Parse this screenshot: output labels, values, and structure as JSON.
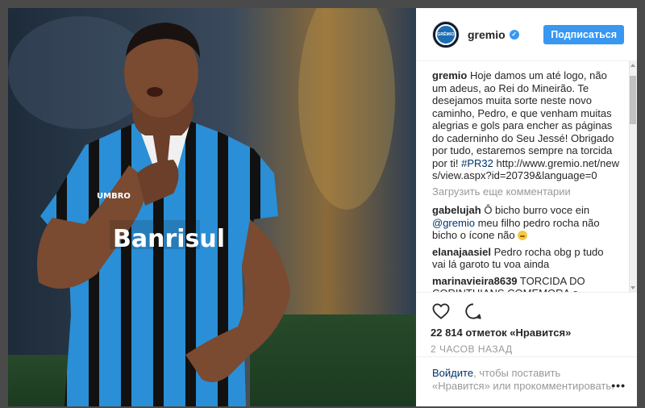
{
  "post": {
    "username": "gremio",
    "avatar_text": "GRÊMIO",
    "follow_label": "Подписаться",
    "caption_user": "gremio",
    "caption_text": "Hoje damos um até logo, não um adeus, ao Rei do Mineirão. Te desejamos muita sorte neste novo caminho, Pedro, e que venham muitas alegrias e gols para encher as páginas do caderninho do Seu Jessé! Obrigado por tudo, estaremos sempre na torcida por ti!",
    "caption_hashtag": "#PR32",
    "caption_url": "http://www.gremio.net/news/view.aspx?id=20739&language=0",
    "load_more": "Загрузить еще комментарии",
    "comments": [
      {
        "user": "gabelujah",
        "text_a": "Ô bicho burro voce ein",
        "mention": "@gremio",
        "text_b": "meu filho pedro rocha não bicho o ícone não"
      },
      {
        "user": "elanajaasiel",
        "text": "Pedro rocha obg p tudo vai lá garoto tu voa ainda"
      },
      {
        "user": "marinavieira8639",
        "text": "TORCIDA DO CORINTHIANS COMEMORA e ..."
      }
    ],
    "likes": "22 814 отметок «Нравится»",
    "time": "2 ЧАСОВ НАЗАД",
    "login_link": "Войдите",
    "login_text": ", чтобы поставить «Нравится» или прокомментировать.",
    "more_label": "•••",
    "icons": {
      "verified": "verified-check-icon",
      "like": "heart-outline-icon",
      "comment": "speech-bubble-icon",
      "more": "ellipsis-icon"
    },
    "photo_text": "Banrisul",
    "shirt_brand": "UMBRO"
  },
  "colors": {
    "accent": "#3897f0",
    "link": "#003569",
    "muted": "#999999",
    "shirt_blue": "#2a8fd6",
    "shirt_black": "#111111"
  }
}
